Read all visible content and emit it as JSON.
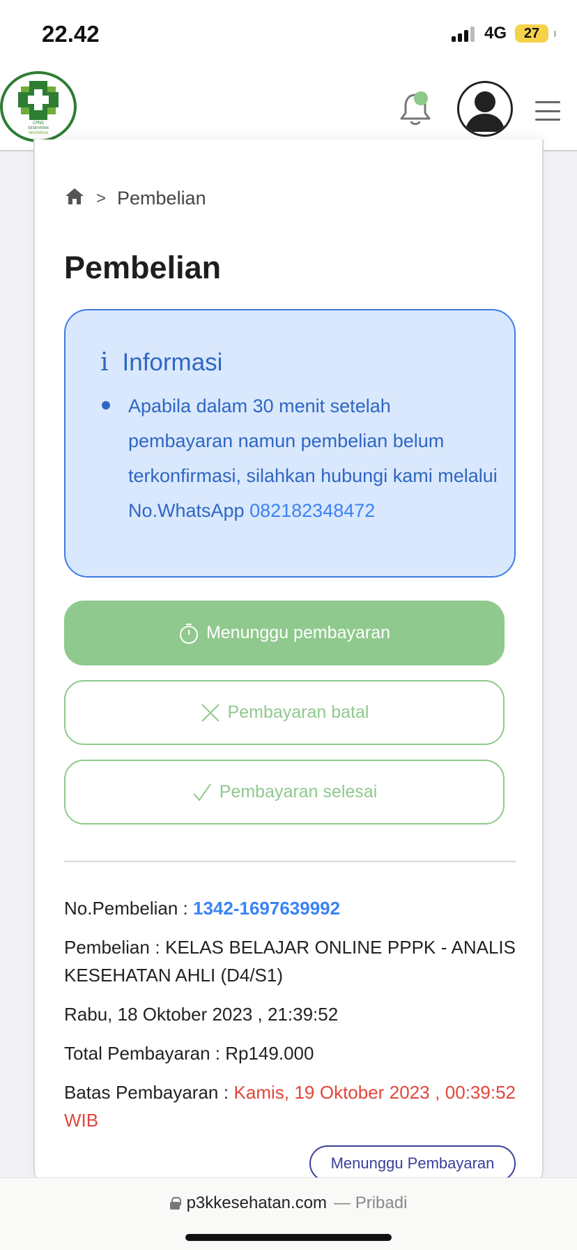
{
  "status_bar": {
    "time": "22.42",
    "network": "4G",
    "battery": "27"
  },
  "header": {
    "logo_text_top": "CPNS",
    "logo_text_mid": "KESEHATAN",
    "logo_text_bottom": "INDONESIA",
    "accent_color": "#2e7d32"
  },
  "breadcrumb": {
    "separator": ">",
    "current": "Pembelian"
  },
  "page": {
    "title": "Pembelian"
  },
  "info": {
    "title": "Informasi",
    "message": "Apabila dalam 30 menit setelah pembayaran namun pembelian belum terkonfirmasi, silahkan hubungi kami melalui No.WhatsApp ",
    "phone": "082182348472"
  },
  "buttons": {
    "waiting": "Menunggu pembayaran",
    "cancelled": "Pembayaran batal",
    "done": "Pembayaran selesai"
  },
  "details": {
    "no_label": "No.Pembelian : ",
    "no_value": "1342-1697639992",
    "item": "Pembelian : KELAS BELAJAR ONLINE PPPK - ANALIS KESEHATAN AHLI (D4/S1)",
    "date": "Rabu, 18 Oktober 2023 , 21:39:52",
    "total": "Total Pembayaran : Rp149.000",
    "limit_label": "Batas Pembayaran : ",
    "limit_value": "Kamis, 19 Oktober 2023 , 00:39:52 WIB"
  },
  "status_pill": "Menunggu Pembayaran",
  "browser": {
    "domain": "p3kkesehatan.com",
    "mode": "— Pribadi"
  },
  "colors": {
    "green": "#8fc98d",
    "blue": "#3b82f6",
    "red": "#e0463b",
    "info_bg": "#d9e8fc"
  }
}
